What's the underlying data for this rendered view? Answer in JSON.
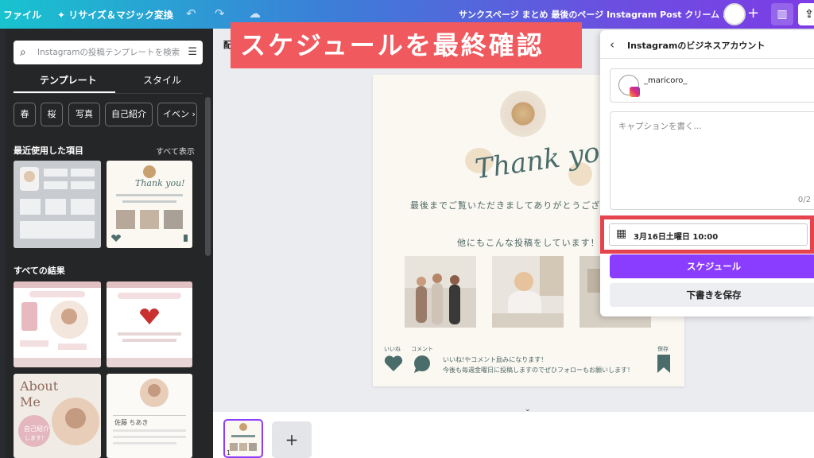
{
  "topbar": {
    "file": "ファイル",
    "resize": "リサイズ＆マジック変換",
    "doc_title": "サンクスページ まとめ 最後のページ Instagram Post クリーム ..."
  },
  "panel": {
    "search_placeholder": "Instagramの投稿テンプレートを検索",
    "tabs": [
      "テンプレート",
      "スタイル"
    ],
    "chips": [
      "春",
      "桜",
      "写真",
      "自己紹介",
      "イベン"
    ],
    "recent_heading": "最近使用した項目",
    "see_all": "すべて表示",
    "all_results_heading": "すべての結果",
    "thumb_texts": {
      "thank_small": "Thank you!",
      "about": "About",
      "me": "Me",
      "self_intro": "自己紹介",
      "shimasu": "します！",
      "name_jp": "佐藤 ちあき"
    }
  },
  "workspace": {
    "tool_hint": "配",
    "banner": "スケジュールを最終確認"
  },
  "canvas": {
    "thank": "Thank you!",
    "message": "最後までご覧いただきましてありがとうござ",
    "other_posts": "他にもこんな投稿をしています！",
    "like_label": "いいね",
    "comment_label": "コメント",
    "save_label": "保存",
    "bottom_line1": "いいね!やコメント励みになります！",
    "bottom_line2": "今後も毎週金曜日に投稿しますのでぜひフォローもお願いします！"
  },
  "filmstrip": {
    "page_number": "1",
    "add_symbol": "+"
  },
  "schedule": {
    "title": "Instagramのビジネスアカウント",
    "account_name": "_maricoro_",
    "caption_placeholder": "キャプションを書く...",
    "char_count": "0/2",
    "date": "3月16日土曜日 10:00",
    "schedule_button": "スケジュール",
    "draft_button": "下書きを保存"
  },
  "icons": {
    "undo": "undo-icon",
    "redo": "redo-icon",
    "cloud": "cloud-icon",
    "search": "search-icon",
    "filter": "filter-icon",
    "back": "chevron-left-icon",
    "calendar": "calendar-icon",
    "chart": "chart-icon",
    "share": "share-icon",
    "instagram": "instagram-icon"
  },
  "colors": {
    "accent": "#8b3dff",
    "banner": "#f05a5e",
    "highlight": "#e5444e",
    "canvas_text": "#4a6d6b"
  }
}
